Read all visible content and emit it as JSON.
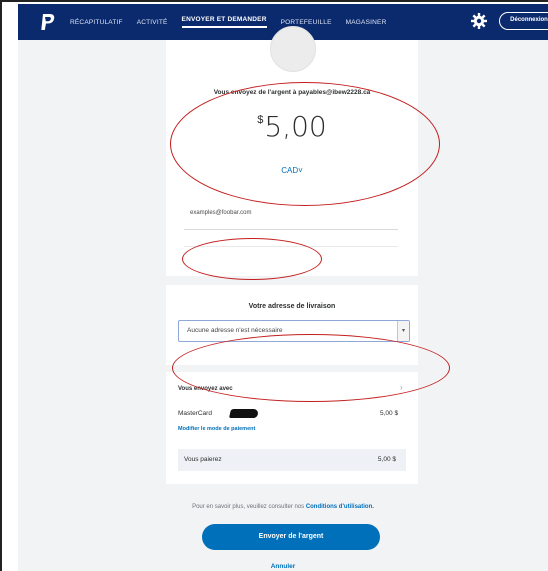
{
  "nav": {
    "items": [
      {
        "label": "RÉCAPITULATIF"
      },
      {
        "label": "ACTIVITÉ"
      },
      {
        "label": "ENVOYER ET DEMANDER"
      },
      {
        "label": "PORTEFEUILLE"
      },
      {
        "label": "MAGASINER"
      }
    ],
    "active_index": 2,
    "logout_label": "Déconnexion",
    "icons": {
      "logo": "paypal-logo",
      "settings": "gear-icon"
    }
  },
  "send": {
    "recipient_text": "Vous envoyez de l'argent à payables@ibew2228.ca",
    "currency_symbol": "$",
    "amount": "5,00",
    "currency_label": "CAD",
    "currency_icon": "chevron-down-icon",
    "note_value": "examples@foobar.com"
  },
  "shipping": {
    "title": "Votre adresse de livraison",
    "selected": "Aucune adresse n'est nécessaire"
  },
  "payment": {
    "title": "Vous envoyez avec",
    "card_label": "MasterCard",
    "card_amount": "5,00 $",
    "modify_label": "Modifier le mode de paiement",
    "total_label": "Vous paierez",
    "total_amount": "5,00 $"
  },
  "footer": {
    "terms_prefix": "Pour en savoir plus, veuillez consulter nos",
    "terms_link": "Conditions d'utilisation.",
    "send_button": "Envoyer de l'argent",
    "cancel_label": "Annuler"
  },
  "colors": {
    "nav_bg": "#0b2a6e",
    "brand_blue": "#0070ba",
    "annotation_red": "#c41e1e",
    "content_bg": "#f2f3f5"
  }
}
